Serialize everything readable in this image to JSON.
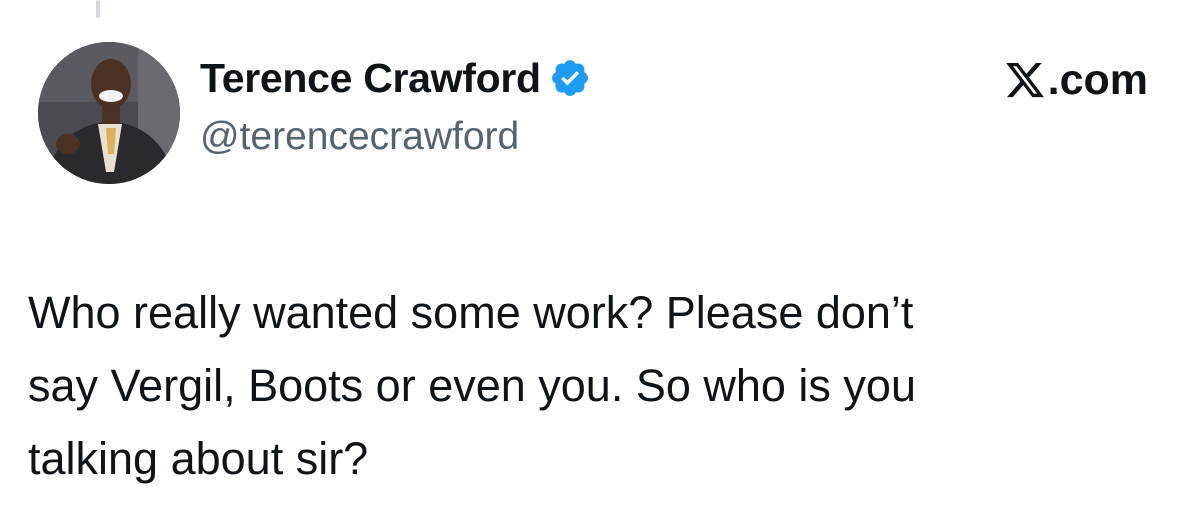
{
  "tweet": {
    "author": {
      "display_name": "Terence Crawford",
      "handle": "@terencecrawford",
      "verified": true,
      "verified_icon": "verified-badge-icon",
      "avatar_icon": "profile-photo"
    },
    "brand": {
      "label": ".com",
      "icon": "x-logo-icon"
    },
    "text": "Who really wanted some work? Please don’t\nsay Vergil, Boots or even you. So who is you\ntalking about sir?"
  },
  "colors": {
    "text": "#0f1419",
    "handle": "#536471",
    "verified_blue": "#1d9bf0",
    "thread_line": "#cfd9de"
  }
}
